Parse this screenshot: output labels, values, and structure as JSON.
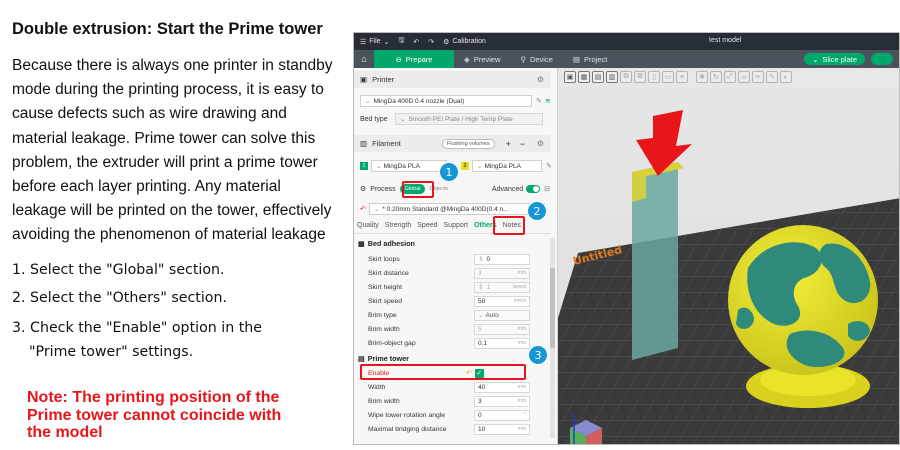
{
  "tutorial": {
    "title": "Double extrusion: Start the Prime tower",
    "paragraph_lines": [
      "Because there is always one printer in standby",
      "mode during the printing process, it is easy to",
      "cause defects such as wire drawing and",
      "material leakage. Prime tower can solve this",
      "problem, the extruder will print a prime tower",
      "before each layer printing. Any material",
      "leakage will be printed on the tower, effectively",
      "avoiding the phenomenon of material leakage"
    ],
    "step1": "1. Select the \"Global\" section.",
    "step2": "2. Select the \"Others\" section.",
    "step3_line1": "3. Check the \"Enable\" option in the",
    "step3_line2": "\"Prime tower\" settings.",
    "note_lines": [
      "Note: The printing position of the",
      "Prime tower cannot coincide with",
      "the model"
    ]
  },
  "app": {
    "menu_file": "File",
    "menu_calibration": "Calibration",
    "window_title": "test model",
    "tabs": {
      "prepare": "Prepare",
      "preview": "Preview",
      "device": "Device",
      "project": "Project"
    },
    "slice_button": "Slice plate"
  },
  "sidebar": {
    "printer_header": "Printer",
    "printer_name": "MingDa 400D 0.4 nozzle (Dual)",
    "bed_type_label": "Bed type",
    "bed_type_value": "Smooth PEI Plate / High Temp Plate",
    "filament_header": "Filament",
    "flushing_volumes": "Flushing volumes",
    "filament_1_num": "1",
    "filament_1": "MingDa PLA",
    "filament_2_num": "2",
    "filament_2": "MingDa PLA",
    "process_label": "Process",
    "global_button": "Global",
    "objects_button": "Objects",
    "advanced_label": "Advanced",
    "process_profile": "* 0.20mm Standard @MingDa 400D(0.4 n...",
    "subtabs": [
      "Quality",
      "Strength",
      "Speed",
      "Support",
      "Others",
      "Notes"
    ],
    "bed_adhesion_title": "Bed adhesion",
    "bed_adhesion": [
      {
        "label": "Skirt loops",
        "value": "0",
        "unit": ""
      },
      {
        "label": "Skirt distance",
        "value": "3",
        "unit": "mm"
      },
      {
        "label": "Skirt height",
        "value": "1",
        "unit": "layers"
      },
      {
        "label": "Skirt speed",
        "value": "50",
        "unit": "mm/s"
      },
      {
        "label": "Brim type",
        "value": "Auto",
        "unit": ""
      },
      {
        "label": "Brim width",
        "value": "5",
        "unit": "mm"
      },
      {
        "label": "Brim-object gap",
        "value": "0.1",
        "unit": "mm"
      }
    ],
    "prime_tower_title": "Prime tower",
    "enable_label": "Enable",
    "prime_tower": [
      {
        "label": "Width",
        "value": "40",
        "unit": "mm"
      },
      {
        "label": "Brim width",
        "value": "3",
        "unit": "mm"
      },
      {
        "label": "Wipe tower rotation angle",
        "value": "0",
        "unit": "°"
      },
      {
        "label": "Maximal bridging distance",
        "value": "10",
        "unit": "mm"
      }
    ]
  },
  "viewport": {
    "plate_label": "Untitled",
    "axis_z": "Z",
    "axis_x": "X"
  },
  "callouts": [
    "1",
    "2",
    "3"
  ],
  "colors": {
    "accent_green": "#00a86b",
    "callout_red": "#e8161a",
    "callout_blue": "#1796d6",
    "globe_yellow": "#e6e01e",
    "globe_teal": "#2f8a7c"
  }
}
